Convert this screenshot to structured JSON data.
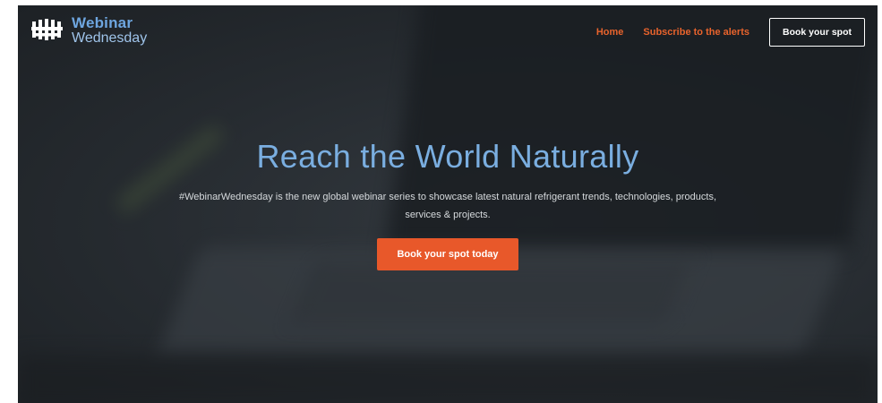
{
  "brand": {
    "name_line1": "Webinar",
    "name_line2": "Wednesday",
    "logo_icon": "webinar-wednesday-logo",
    "primary_color": "#6ea6e0",
    "accent_color": "#e8582a"
  },
  "nav": {
    "items": [
      {
        "label": "Home"
      },
      {
        "label": "Subscribe to the alerts"
      }
    ],
    "cta_label": "Book your spot"
  },
  "hero": {
    "title": "Reach the World Naturally",
    "description": "#WebinarWednesday is the new global webinar series to showcase latest natural refrigerant trends, technologies, products, services & projects.",
    "cta_label": "Book your spot today"
  }
}
